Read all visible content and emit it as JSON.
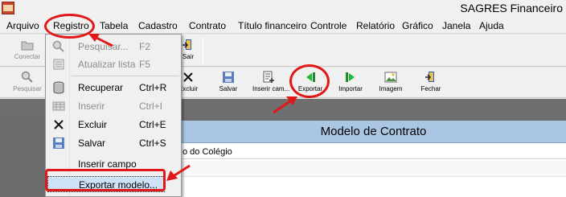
{
  "window": {
    "title": "SAGRES Financeiro",
    "icon": "app-icon"
  },
  "menubar": {
    "items": [
      "Arquivo",
      "Registro",
      "Tabela",
      "Cadastro",
      "Contrato",
      "Título financeiro",
      "Controle",
      "Relatório",
      "Gráfico",
      "Janela",
      "Ajuda"
    ]
  },
  "toolbar1": {
    "buttons": [
      {
        "label": "Conectar",
        "icon": "folder-icon"
      },
      {
        "label": "Sair",
        "icon": "exit-door-icon"
      }
    ]
  },
  "toolbar2": {
    "buttons": [
      {
        "label": "Pesquisar",
        "icon": "magnifier-icon"
      },
      {
        "label": "Excluir",
        "icon": "delete-x-icon"
      },
      {
        "label": "Salvar",
        "icon": "floppy-icon"
      },
      {
        "label": "Inserir cam...",
        "icon": "insert-field-icon"
      },
      {
        "label": "Exportar",
        "icon": "export-arrow-icon"
      },
      {
        "label": "Importar",
        "icon": "import-arrow-icon"
      },
      {
        "label": "Imagem",
        "icon": "image-icon"
      },
      {
        "label": "Fechar",
        "icon": "close-door-icon"
      }
    ]
  },
  "registro_menu": {
    "items": [
      {
        "label": "Pesquisar...",
        "shortcut": "F2",
        "enabled": false,
        "icon": "magnifier-icon"
      },
      {
        "label": "Atualizar lista",
        "shortcut": "F5",
        "enabled": false,
        "icon": "refresh-list-icon"
      },
      {
        "label": "Recuperar",
        "shortcut": "Ctrl+R",
        "enabled": true,
        "icon": "database-icon"
      },
      {
        "label": "Inserir",
        "shortcut": "Ctrl+I",
        "enabled": false,
        "icon": "insert-table-icon"
      },
      {
        "label": "Excluir",
        "shortcut": "Ctrl+E",
        "enabled": true,
        "icon": "delete-x-icon"
      },
      {
        "label": "Salvar",
        "shortcut": "Ctrl+S",
        "enabled": true,
        "icon": "floppy-icon"
      },
      {
        "label": "Inserir campo",
        "shortcut": "",
        "enabled": true,
        "icon": ""
      },
      {
        "label": "Exportar modelo...",
        "shortcut": "",
        "enabled": true,
        "highlighted": true,
        "icon": ""
      }
    ]
  },
  "model_panel": {
    "title": "Modelo de Contrato",
    "field_value": "o do Colégio"
  },
  "colors": {
    "annotation_red": "#e01818",
    "panel_header_blue": "#abc6e2",
    "highlight": "#cfe2f7",
    "background_dark": "#6c6c6c"
  }
}
